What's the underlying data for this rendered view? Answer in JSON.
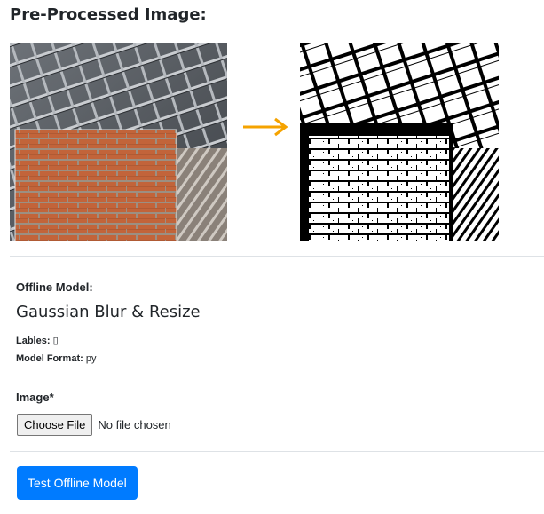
{
  "page_title": "Pre-Processed Image:",
  "model": {
    "heading": "Offline Model:",
    "name": "Gaussian Blur & Resize",
    "labels_label": "Lables:",
    "labels_value": "▯",
    "format_label": "Model Format:",
    "format_value": "py"
  },
  "image_input": {
    "label": "Image*",
    "button_label": "Choose File",
    "status": "No file chosen"
  },
  "submit_label": "Test Offline Model",
  "colors": {
    "accent": "#f5a300",
    "primary": "#007bff",
    "brick": "#c2643a"
  }
}
